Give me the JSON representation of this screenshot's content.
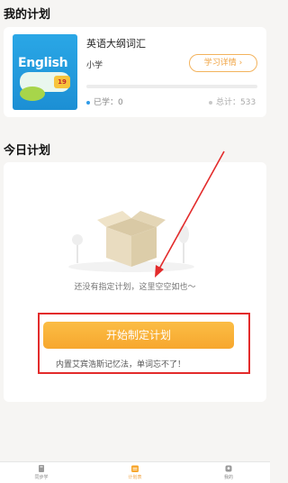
{
  "my_plan": {
    "section_title": "我的计划",
    "book": {
      "cover_title": "English",
      "cover_badge": "19",
      "name": "英语大纲词汇",
      "level": "小学",
      "detail_button": "学习详情 ›",
      "learned_label": "已学：0",
      "total_label": "总计：533",
      "progress": 0
    }
  },
  "today_plan": {
    "section_title": "今日计划",
    "empty_text": "还没有指定计划，这里空空如也～",
    "start_button": "开始制定计划",
    "tip": "内置艾宾浩斯记忆法，单词忘不了！"
  },
  "tabbar": {
    "items": [
      {
        "label": "同步学",
        "icon": "book-icon"
      },
      {
        "label": "计划表",
        "icon": "calendar-icon"
      },
      {
        "label": "我的",
        "icon": "profile-icon"
      }
    ]
  },
  "colors": {
    "accent": "#f7a72e",
    "highlight": "#e32b2b",
    "blue_dot": "#2f9be8",
    "gray_dot": "#c8c8c8"
  }
}
